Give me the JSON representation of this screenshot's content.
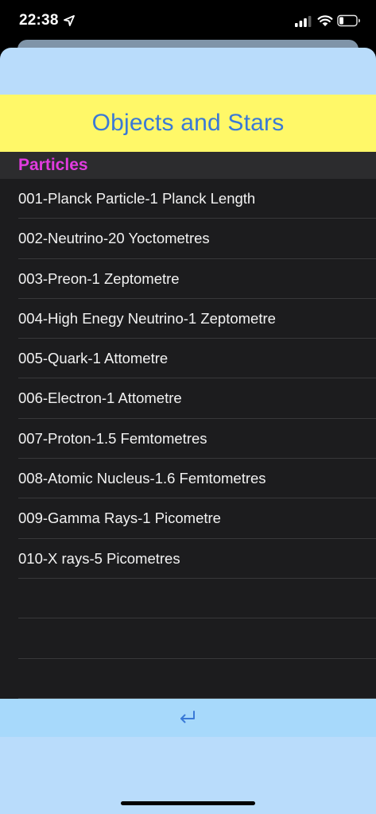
{
  "status_bar": {
    "time": "22:38"
  },
  "header": {
    "title": "Objects and Stars"
  },
  "section": {
    "title": "Particles"
  },
  "rows": [
    "001-Planck Particle-1 Planck Length",
    "002-Neutrino-20 Yoctometres",
    "003-Preon-1 Zeptometre",
    "004-High Enegy Neutrino-1 Zeptometre",
    "005-Quark-1 Attometre",
    "006-Electron-1 Attometre",
    "007-Proton-1.5 Femtometres",
    "008-Atomic Nucleus-1.6 Femtometres",
    "009-Gamma Rays-1 Picometre",
    "010-X rays-5 Picometres",
    "",
    "",
    ""
  ],
  "colors": {
    "title_text": "#3a79d6",
    "title_banner": "#fff868",
    "section_title": "#e23be0",
    "sheet_background": "#b9dcfb",
    "list_background": "#1c1c1e",
    "footer_background": "#a7d9fb",
    "return_icon": "#3a79d6"
  },
  "icons": {
    "location": "location-arrow-icon",
    "signal": "cellular-signal-icon",
    "wifi": "wifi-icon",
    "battery": "battery-icon",
    "return": "return-arrow-icon"
  }
}
